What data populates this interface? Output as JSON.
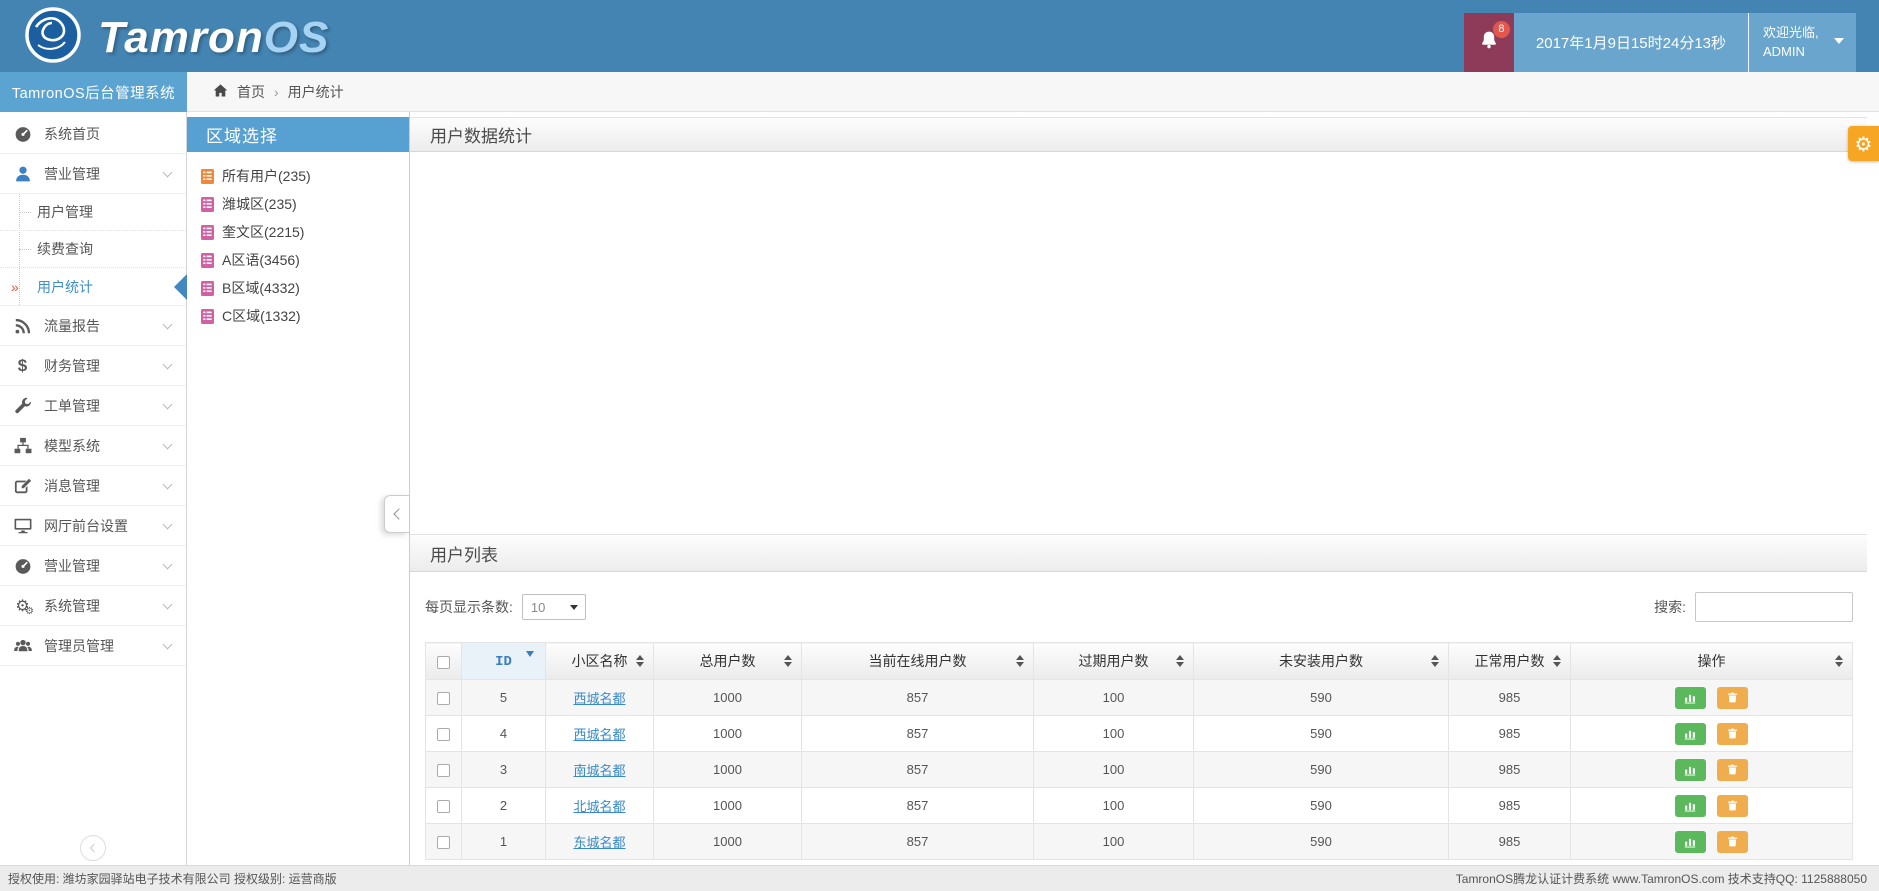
{
  "brand": {
    "logo_text_1": "Tamron",
    "logo_text_2": "OS",
    "system_title": "TamronOS后台管理系统"
  },
  "topbar": {
    "notification_count": "8",
    "datetime": "2017年1月9日15时24分13秒",
    "welcome": "欢迎光临,",
    "username": "ADMIN"
  },
  "breadcrumb": {
    "home": "首页",
    "separator": "›",
    "current": "用户统计"
  },
  "sidebar": {
    "items": [
      {
        "label": "系统首页",
        "icon": "dashboard-icon"
      },
      {
        "label": "营业管理",
        "icon": "user-icon",
        "expanded": true,
        "children": [
          {
            "label": "用户管理"
          },
          {
            "label": "续费查询"
          },
          {
            "label": "用户统计",
            "active": true
          }
        ]
      },
      {
        "label": "流量报告",
        "icon": "rss-icon"
      },
      {
        "label": "财务管理",
        "icon": "dollar-icon"
      },
      {
        "label": "工单管理",
        "icon": "wrench-icon"
      },
      {
        "label": "模型系统",
        "icon": "sitemap-icon"
      },
      {
        "label": "消息管理",
        "icon": "compose-icon"
      },
      {
        "label": "网厅前台设置",
        "icon": "desktop-icon"
      },
      {
        "label": "营业管理",
        "icon": "gauge-icon"
      },
      {
        "label": "系统管理",
        "icon": "gears-icon"
      },
      {
        "label": "管理员管理",
        "icon": "users-icon"
      }
    ]
  },
  "region_panel": {
    "title": "区域选择",
    "items": [
      {
        "label": "所有用户(235)",
        "icon_color": "#f0883a"
      },
      {
        "label": "潍城区(235)",
        "icon_color": "#d160a5"
      },
      {
        "label": "奎文区(2215)",
        "icon_color": "#d160a5"
      },
      {
        "label": "A区语(3456)",
        "icon_color": "#d160a5"
      },
      {
        "label": "B区域(4332)",
        "icon_color": "#d160a5"
      },
      {
        "label": "C区域(1332)",
        "icon_color": "#d160a5"
      }
    ]
  },
  "main": {
    "stats_panel_title": "用户数据统计",
    "list_panel_title": "用户列表",
    "toolbar": {
      "per_page_label": "每页显示条数:",
      "per_page_value": "10",
      "search_label": "搜索:",
      "search_value": ""
    },
    "table": {
      "columns": [
        "ID",
        "小区名称",
        "总用户数",
        "当前在线用户数",
        "过期用户数",
        "未安装用户数",
        "正常用户数",
        "操作"
      ],
      "sorted_column": "ID",
      "sort_direction": "desc",
      "rows": [
        {
          "id": "5",
          "name": "西城名都",
          "total": "1000",
          "online": "857",
          "expired": "100",
          "uninstalled": "590",
          "normal": "985"
        },
        {
          "id": "4",
          "name": "西城名都",
          "total": "1000",
          "online": "857",
          "expired": "100",
          "uninstalled": "590",
          "normal": "985"
        },
        {
          "id": "3",
          "name": "南城名都",
          "total": "1000",
          "online": "857",
          "expired": "100",
          "uninstalled": "590",
          "normal": "985"
        },
        {
          "id": "2",
          "name": "北城名都",
          "total": "1000",
          "online": "857",
          "expired": "100",
          "uninstalled": "590",
          "normal": "985"
        },
        {
          "id": "1",
          "name": "东城名都",
          "total": "1000",
          "online": "857",
          "expired": "100",
          "uninstalled": "590",
          "normal": "985"
        }
      ]
    }
  },
  "footer": {
    "left": "授权使用: 潍坊家园驿站电子技术有限公司  授权级别: 运营商版",
    "right": "TamronOS腾龙认证计费系统 www.TamronOS.com 技术支持QQ: 1125888050"
  },
  "colors": {
    "header_blue": "#4484b2",
    "header_light_blue": "#69a5cd",
    "sidebar_band_blue": "#5ba3d0",
    "panel_header_blue": "#57a0d2",
    "notification_maroon": "#8e3b59",
    "badge_red": "#e2574c",
    "active_link_blue": "#3e8fc9",
    "table_link_blue": "#3989c8",
    "chart_button_green": "#5cb85c",
    "delete_button_orange": "#f0ad4e",
    "settings_gear_orange": "#f6a623",
    "region_icon_orange": "#f0883a",
    "region_icon_pink": "#d160a5"
  }
}
